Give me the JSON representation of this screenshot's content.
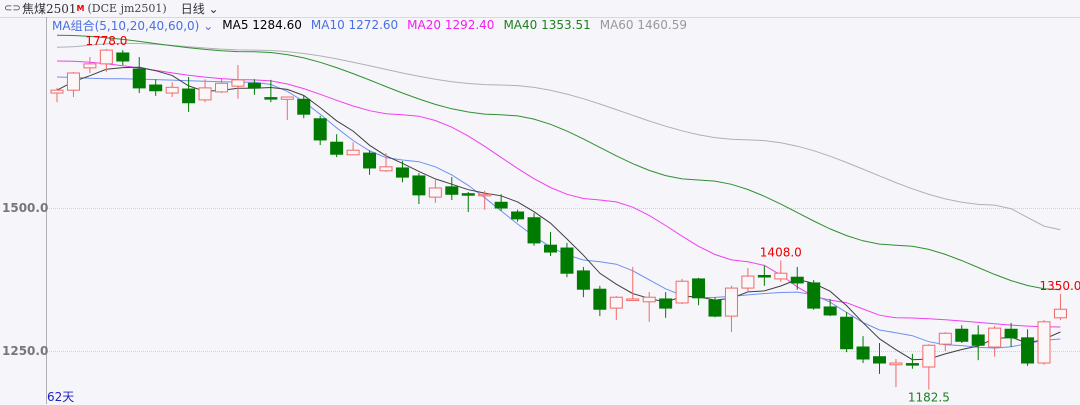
{
  "header": {
    "icon": "link-icon",
    "title": "焦煤2501",
    "badge": "M",
    "code": "(DCE  jm2501)",
    "period": "日线",
    "period_icon": "chevron-down-icon"
  },
  "legend": {
    "combo": "MA组合(5,10,20,40,60,0)",
    "ma5": "MA5 1284.60",
    "ma10": "MA10 1272.60",
    "ma20": "MA20 1292.40",
    "ma40": "MA40 1353.51",
    "ma60": "MA60 1460.59"
  },
  "axis": {
    "y1": "1500.0",
    "y2": "1250.0",
    "days": "62天"
  },
  "colors": {
    "up": "#f06a6a",
    "down": "#007a00",
    "ma5": "#404040",
    "ma10": "#7090f0",
    "ma20": "#f040f0",
    "ma40": "#309030",
    "ma60": "#b0b0b8"
  },
  "annotations": {
    "high": "1778.0",
    "high2": "1408.0",
    "last": "1350.0",
    "low": "1182.5"
  },
  "chart_data": {
    "type": "candlestick",
    "count": 62,
    "ohlc": [
      [
        1701,
        1706,
        1710,
        1685
      ],
      [
        1706,
        1736,
        1738,
        1694
      ],
      [
        1745,
        1752,
        1764,
        1736
      ],
      [
        1752,
        1776,
        1778,
        1738
      ],
      [
        1771,
        1757,
        1776,
        1750
      ],
      [
        1743,
        1710,
        1764,
        1701
      ],
      [
        1715,
        1705,
        1725,
        1696
      ],
      [
        1701,
        1711,
        1720,
        1694
      ],
      [
        1708,
        1684,
        1729,
        1668
      ],
      [
        1689,
        1710,
        1725,
        1685
      ],
      [
        1703,
        1718,
        1727,
        1701
      ],
      [
        1713,
        1724,
        1750,
        1691
      ],
      [
        1718,
        1710,
        1725,
        1698
      ],
      [
        1693,
        1691,
        1724,
        1685
      ],
      [
        1690,
        1694,
        1694,
        1654
      ],
      [
        1690,
        1664,
        1696,
        1657
      ],
      [
        1656,
        1619,
        1661,
        1610
      ],
      [
        1615,
        1594,
        1629,
        1589
      ],
      [
        1593,
        1601,
        1615,
        1593
      ],
      [
        1596,
        1570,
        1601,
        1558
      ],
      [
        1565,
        1572,
        1596,
        1563
      ],
      [
        1570,
        1554,
        1582,
        1545
      ],
      [
        1556,
        1523,
        1561,
        1507
      ],
      [
        1519,
        1535,
        1549,
        1509
      ],
      [
        1537,
        1524,
        1554,
        1514
      ],
      [
        1525,
        1524,
        1528,
        1493
      ],
      [
        1522,
        1524,
        1530,
        1497
      ],
      [
        1510,
        1500,
        1524,
        1495
      ],
      [
        1493,
        1481,
        1497,
        1476
      ],
      [
        1483,
        1439,
        1491,
        1434
      ],
      [
        1435,
        1423,
        1458,
        1416
      ],
      [
        1430,
        1386,
        1439,
        1379
      ],
      [
        1390,
        1358,
        1397,
        1344
      ],
      [
        1358,
        1323,
        1364,
        1311
      ],
      [
        1325,
        1344,
        1346,
        1304
      ],
      [
        1339,
        1341,
        1397,
        1339
      ],
      [
        1336,
        1344,
        1353,
        1301
      ],
      [
        1341,
        1325,
        1353,
        1308
      ],
      [
        1334,
        1372,
        1376,
        1332
      ],
      [
        1376,
        1343,
        1378,
        1330
      ],
      [
        1339,
        1311,
        1344,
        1309
      ],
      [
        1311,
        1360,
        1364,
        1283
      ],
      [
        1360,
        1381,
        1395,
        1353
      ],
      [
        1382,
        1380,
        1399,
        1364
      ],
      [
        1376,
        1386,
        1408,
        1371
      ],
      [
        1379,
        1369,
        1397,
        1357
      ],
      [
        1369,
        1325,
        1374,
        1322
      ],
      [
        1327,
        1313,
        1341,
        1311
      ],
      [
        1309,
        1254,
        1318,
        1248
      ],
      [
        1257,
        1236,
        1276,
        1229
      ],
      [
        1240,
        1229,
        1264,
        1210
      ],
      [
        1226,
        1229,
        1236,
        1187
      ],
      [
        1228,
        1226,
        1245,
        1219
      ],
      [
        1222,
        1260,
        1262,
        1182.5
      ],
      [
        1262,
        1281,
        1283,
        1250
      ],
      [
        1288,
        1267,
        1295,
        1264
      ],
      [
        1278,
        1260,
        1295,
        1234
      ],
      [
        1257,
        1290,
        1294,
        1240
      ],
      [
        1288,
        1273,
        1299,
        1257
      ],
      [
        1273,
        1229,
        1288,
        1224
      ],
      [
        1229,
        1301,
        1304,
        1226
      ],
      [
        1308,
        1323,
        1350,
        1304
      ]
    ],
    "ma10": [
      [
        0,
        1729
      ],
      [
        3,
        1726
      ],
      [
        12,
        1720
      ],
      [
        21,
        1584
      ],
      [
        33,
        1406
      ],
      [
        39,
        1343
      ],
      [
        45,
        1353
      ],
      [
        51,
        1282
      ],
      [
        54,
        1261
      ],
      [
        57,
        1255
      ],
      [
        61,
        1271
      ]
    ],
    "ma20": [
      [
        0,
        1757
      ],
      [
        12,
        1724
      ],
      [
        21,
        1663
      ],
      [
        33,
        1514
      ],
      [
        42,
        1406
      ],
      [
        47,
        1339
      ],
      [
        51,
        1308
      ],
      [
        61,
        1292
      ]
    ],
    "ma40": [
      [
        0,
        1802
      ],
      [
        12,
        1773
      ],
      [
        27,
        1663
      ],
      [
        39,
        1549
      ],
      [
        51,
        1435
      ],
      [
        61,
        1357
      ]
    ],
    "ma60": [
      [
        0,
        1781
      ],
      [
        4,
        1788
      ],
      [
        12,
        1776
      ],
      [
        27,
        1715
      ],
      [
        42,
        1619
      ],
      [
        57,
        1505
      ],
      [
        61,
        1462
      ]
    ],
    "ylabels": [
      1500,
      1250
    ]
  }
}
